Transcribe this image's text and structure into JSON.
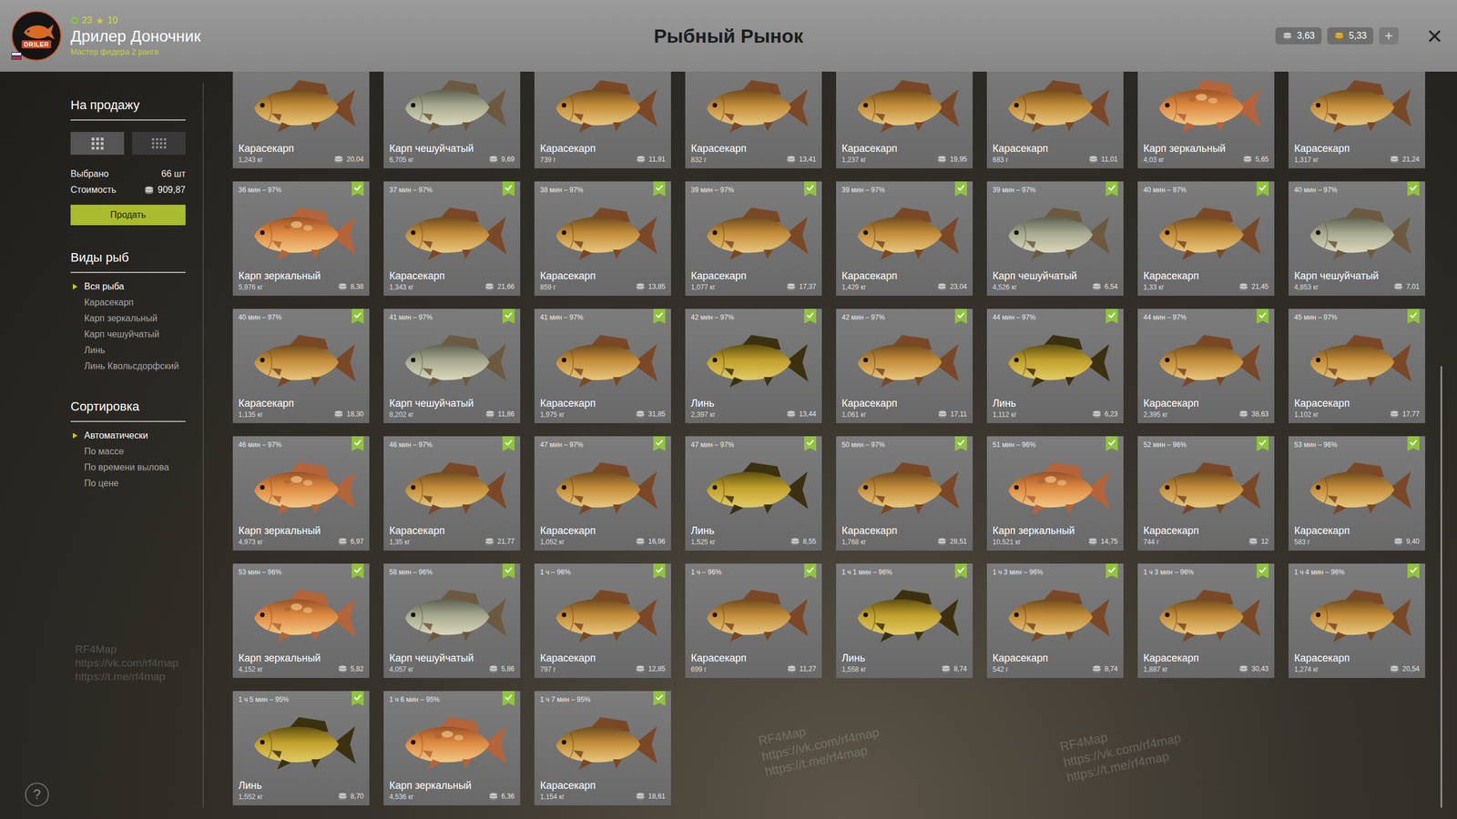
{
  "header": {
    "logo": "DRILER",
    "level": "23",
    "stars": "10",
    "player_name": "Дрилер Доночник",
    "player_rank": "Мастер фидера 2 ранга",
    "title": "Рыбный Рынок",
    "currencies": [
      {
        "value": "3,63",
        "kind": "silver"
      },
      {
        "value": "5,33",
        "kind": "gold"
      }
    ],
    "add_button": "+",
    "close_button": "×"
  },
  "sidebar": {
    "sale_title": "На продажу",
    "view_modes": [
      {
        "selected": true
      },
      {
        "selected": false
      }
    ],
    "stats": [
      {
        "label": "Выбрано",
        "value": "66 шт",
        "kind": "count"
      },
      {
        "label": "Стоимость",
        "value": "909,87",
        "kind": "money"
      }
    ],
    "sell_button": "Продать",
    "species_title": "Виды рыб",
    "species": [
      {
        "label": "Вся рыба",
        "selected": true
      },
      {
        "label": "Карасекарп",
        "selected": false
      },
      {
        "label": "Карп зеркальный",
        "selected": false
      },
      {
        "label": "Карп чешуйчатый",
        "selected": false
      },
      {
        "label": "Линь",
        "selected": false
      },
      {
        "label": "Линь Квольсдорфский",
        "selected": false
      }
    ],
    "sort_title": "Сортировка",
    "sort": [
      {
        "label": "Автоматически",
        "selected": true
      },
      {
        "label": "По массе",
        "selected": false
      },
      {
        "label": "По времени вылова",
        "selected": false
      },
      {
        "label": "По цене",
        "selected": false
      }
    ]
  },
  "cards": [
    {
      "name": "Карасекарп",
      "weight": "1,243 кг",
      "price": "20,04",
      "kind": "karasekarp"
    },
    {
      "name": "Карп чешуйчатый",
      "weight": "6,705 кг",
      "price": "9,69",
      "kind": "common"
    },
    {
      "name": "Карасекарп",
      "weight": "739 г",
      "price": "11,91",
      "kind": "karasekarp"
    },
    {
      "name": "Карасекарп",
      "weight": "832 г",
      "price": "13,41",
      "kind": "karasekarp"
    },
    {
      "name": "Карасекарп",
      "weight": "1,237 кг",
      "price": "19,95",
      "kind": "karasekarp"
    },
    {
      "name": "Карасекарп",
      "weight": "683 г",
      "price": "11,01",
      "kind": "karasekarp"
    },
    {
      "name": "Карп зеркальный",
      "weight": "4,03 кг",
      "price": "5,65",
      "kind": "mirror"
    },
    {
      "name": "Карасекарп",
      "weight": "1,317 кг",
      "price": "21,24",
      "kind": "karasekarp"
    },
    {
      "time": "36 мин – 97%",
      "name": "Карп зеркальный",
      "weight": "5,976 кг",
      "price": "8,38",
      "kind": "mirror",
      "selected": true
    },
    {
      "time": "37 мин – 97%",
      "name": "Карасекарп",
      "weight": "1,343 кг",
      "price": "21,66",
      "kind": "karasekarp",
      "selected": true
    },
    {
      "time": "38 мин – 97%",
      "name": "Карасекарп",
      "weight": "859 г",
      "price": "13,85",
      "kind": "karasekarp",
      "selected": true
    },
    {
      "time": "39 мин – 97%",
      "name": "Карасекарп",
      "weight": "1,077 кг",
      "price": "17,37",
      "kind": "karasekarp",
      "selected": true
    },
    {
      "time": "39 мин – 97%",
      "name": "Карасекарп",
      "weight": "1,429 кг",
      "price": "23,04",
      "kind": "karasekarp",
      "selected": true
    },
    {
      "time": "39 мин – 97%",
      "name": "Карп чешуйчатый",
      "weight": "4,526 кг",
      "price": "6,54",
      "kind": "common",
      "selected": true
    },
    {
      "time": "40 мин – 97%",
      "name": "Карасекарп",
      "weight": "1,33 кг",
      "price": "21,45",
      "kind": "karasekarp",
      "selected": true
    },
    {
      "time": "40 мин – 97%",
      "name": "Карп чешуйчатый",
      "weight": "4,853 кг",
      "price": "7,01",
      "kind": "common",
      "selected": true
    },
    {
      "time": "40 мин – 97%",
      "name": "Карасекарп",
      "weight": "1,135 кг",
      "price": "18,30",
      "kind": "karasekarp",
      "selected": true
    },
    {
      "time": "41 мин – 97%",
      "name": "Карп чешуйчатый",
      "weight": "8,202 кг",
      "price": "11,86",
      "kind": "common",
      "selected": true
    },
    {
      "time": "41 мин – 97%",
      "name": "Карасекарп",
      "weight": "1,975 кг",
      "price": "31,85",
      "kind": "karasekarp",
      "selected": true
    },
    {
      "time": "42 мин – 97%",
      "name": "Линь",
      "weight": "2,397 кг",
      "price": "13,44",
      "kind": "tench",
      "selected": true
    },
    {
      "time": "42 мин – 97%",
      "name": "Карасекарп",
      "weight": "1,061 кг",
      "price": "17,11",
      "kind": "karasekarp",
      "selected": true
    },
    {
      "time": "44 мин – 97%",
      "name": "Линь",
      "weight": "1,112 кг",
      "price": "6,23",
      "kind": "tench",
      "selected": true
    },
    {
      "time": "44 мин – 97%",
      "name": "Карасекарп",
      "weight": "2,395 кг",
      "price": "38,63",
      "kind": "karasekarp",
      "selected": true
    },
    {
      "time": "45 мин – 97%",
      "name": "Карасекарп",
      "weight": "1,102 кг",
      "price": "17,77",
      "kind": "karasekarp",
      "selected": true
    },
    {
      "time": "46 мин – 97%",
      "name": "Карп зеркальный",
      "weight": "4,973 кг",
      "price": "6,97",
      "kind": "mirror",
      "selected": true
    },
    {
      "time": "46 мин – 97%",
      "name": "Карасекарп",
      "weight": "1,35 кг",
      "price": "21,77",
      "kind": "karasekarp",
      "selected": true
    },
    {
      "time": "47 мин – 97%",
      "name": "Карасекарп",
      "weight": "1,052 кг",
      "price": "16,96",
      "kind": "karasekarp",
      "selected": true
    },
    {
      "time": "47 мин – 97%",
      "name": "Линь",
      "weight": "1,525 кг",
      "price": "8,55",
      "kind": "tench",
      "selected": true
    },
    {
      "time": "50 мин – 97%",
      "name": "Карасекарп",
      "weight": "1,768 кг",
      "price": "28,51",
      "kind": "karasekarp",
      "selected": true
    },
    {
      "time": "51 мин – 96%",
      "name": "Карп зеркальный",
      "weight": "10,521 кг",
      "price": "14,75",
      "kind": "mirror",
      "selected": true
    },
    {
      "time": "52 мин – 96%",
      "name": "Карасекарп",
      "weight": "744 г",
      "price": "12",
      "kind": "karasekarp",
      "selected": true
    },
    {
      "time": "53 мин – 96%",
      "name": "Карасекарп",
      "weight": "583 г",
      "price": "9,40",
      "kind": "karasekarp",
      "selected": true
    },
    {
      "time": "53 мин – 96%",
      "name": "Карп зеркальный",
      "weight": "4,152 кг",
      "price": "5,82",
      "kind": "mirror",
      "selected": true
    },
    {
      "time": "58 мин – 96%",
      "name": "Карп чешуйчатый",
      "weight": "4,057 кг",
      "price": "5,86",
      "kind": "common",
      "selected": true
    },
    {
      "time": "1 ч – 96%",
      "name": "Карасекарп",
      "weight": "797 г",
      "price": "12,85",
      "kind": "karasekarp",
      "selected": true
    },
    {
      "time": "1 ч – 96%",
      "name": "Карасекарп",
      "weight": "699 г",
      "price": "11,27",
      "kind": "karasekarp",
      "selected": true
    },
    {
      "time": "1 ч 1 мин – 96%",
      "name": "Линь",
      "weight": "1,558 кг",
      "price": "8,74",
      "kind": "tench",
      "selected": true
    },
    {
      "time": "1 ч 3 мин – 96%",
      "name": "Карасекарп",
      "weight": "542 г",
      "price": "8,74",
      "kind": "karasekarp",
      "selected": true
    },
    {
      "time": "1 ч 3 мин – 96%",
      "name": "Карасекарп",
      "weight": "1,887 кг",
      "price": "30,43",
      "kind": "karasekarp",
      "selected": true
    },
    {
      "time": "1 ч 4 мин – 96%",
      "name": "Карасекарп",
      "weight": "1,274 кг",
      "price": "20,54",
      "kind": "karasekarp",
      "selected": true
    },
    {
      "time": "1 ч 5 мин – 95%",
      "name": "Линь",
      "weight": "1,552 кг",
      "price": "8,70",
      "kind": "tench",
      "selected": true
    },
    {
      "time": "1 ч 6 мин – 95%",
      "name": "Карп зеркальный",
      "weight": "4,536 кг",
      "price": "6,36",
      "kind": "mirror",
      "selected": true
    },
    {
      "time": "1 ч 7 мин – 95%",
      "name": "Карасекарп",
      "weight": "1,154 кг",
      "price": "18,61",
      "kind": "karasekarp",
      "selected": true
    }
  ],
  "scrollbar": {
    "level": 0.6
  },
  "help": "?",
  "watermarks": [
    [
      "RF4Map",
      "https://vk.com/rf4map",
      "https://t.me/rf4map"
    ],
    [
      "RF4Map",
      "https://vk.com/rf4map",
      "https://t.me/rf4map"
    ],
    [
      "RF4Map",
      "https://vk.com/rf4map",
      "https://t.me/rf4map"
    ]
  ]
}
